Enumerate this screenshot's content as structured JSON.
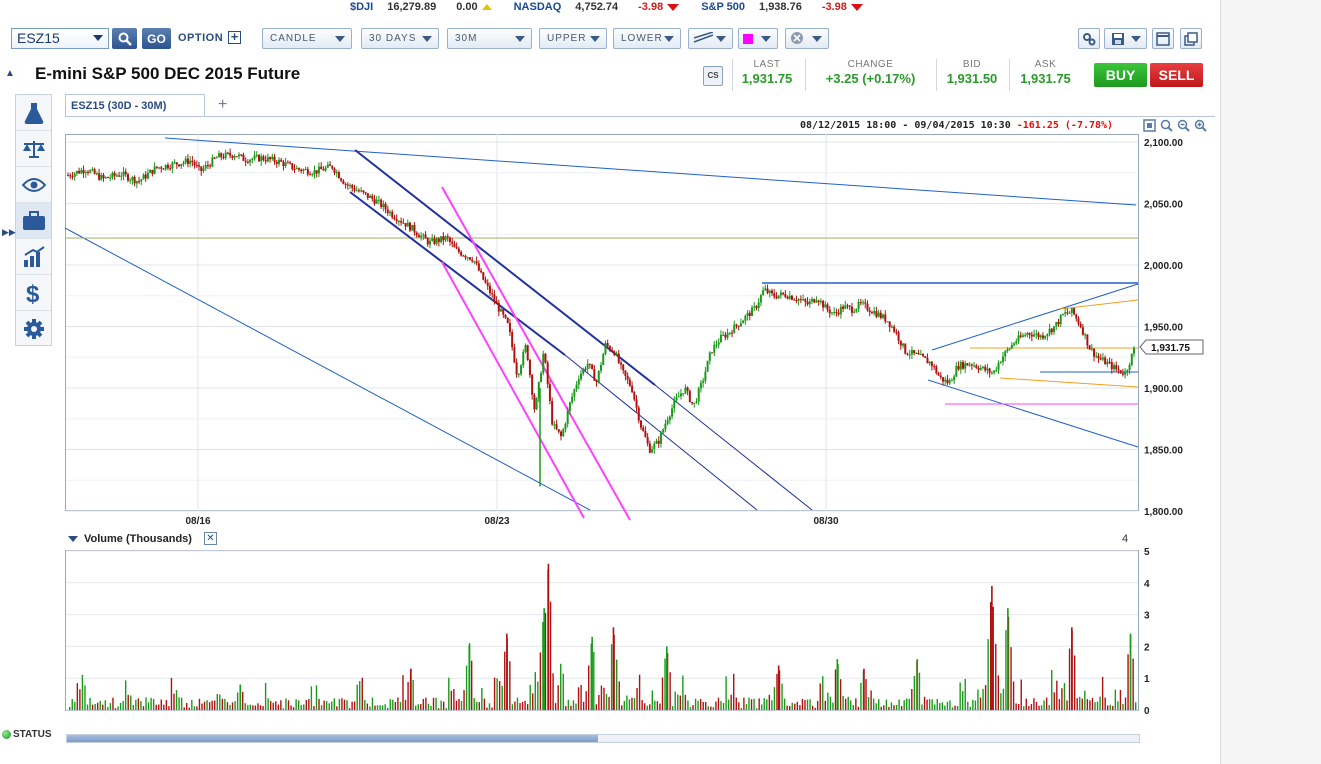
{
  "ticker": [
    {
      "symbol": "$DJI",
      "value": "16,279.89",
      "change": "0.00",
      "direction": "flat"
    },
    {
      "symbol": "NASDAQ",
      "value": "4,752.74",
      "change": "-3.98",
      "direction": "down"
    },
    {
      "symbol": "S&P 500",
      "value": "1,938.76",
      "change": "-3.98",
      "direction": "down"
    }
  ],
  "toolbar": {
    "symbol": "ESZ15",
    "go_label": "GO",
    "option_label": "OPTION",
    "chart_style": "CANDLE",
    "range": "30 DAYS",
    "interval": "30M",
    "upper": "UPPER",
    "lower": "LOWER",
    "draw_color": "#ff00ff"
  },
  "header": {
    "title": "E-mini S&P 500 DEC 2015 Future",
    "cs_label": "CS",
    "quotes": [
      {
        "label": "LAST",
        "value": "1,931.75"
      },
      {
        "label": "CHANGE",
        "value": "+3.25 (+0.17%)"
      },
      {
        "label": "BID",
        "value": "1,931.50"
      },
      {
        "label": "ASK",
        "value": "1,931.75"
      }
    ],
    "buy_label": "BUY",
    "sell_label": "SELL"
  },
  "side_tools": [
    "flask-icon",
    "scales-icon",
    "eye-icon",
    "briefcase-icon",
    "bar-chart-icon",
    "dollar-icon",
    "gear-icon"
  ],
  "chart": {
    "tab_label": "ESZ15 (30D - 30M)",
    "range_text": "08/12/2015 18:00 - 09/04/2015 10:30",
    "range_change": "-161.25 (-7.78%)",
    "last_price_tag": "1,931.75",
    "volume_label": "Volume (Thousands)",
    "volume_right_label": "4"
  },
  "chart_data": [
    {
      "type": "candlestick",
      "series_colors": {
        "up": "#1a9a1a",
        "down": "#b01010"
      },
      "y_ticks": [
        "2,100.00",
        "2,050.00",
        "2,000.00",
        "1,950.00",
        "1,900.00",
        "1,850.00",
        "1,800.00"
      ],
      "ylim": [
        1800,
        2100
      ],
      "x_ticks": [
        "08/16",
        "08/23",
        "08/30"
      ],
      "close_path": [
        [
          0,
          2073
        ],
        [
          4,
          2078
        ],
        [
          8,
          2070
        ],
        [
          12,
          2074
        ],
        [
          16,
          2068
        ],
        [
          20,
          2079
        ],
        [
          24,
          2082
        ],
        [
          28,
          2085
        ],
        [
          30,
          2076
        ],
        [
          34,
          2088
        ],
        [
          38,
          2090
        ],
        [
          40,
          2086
        ],
        [
          44,
          2087
        ],
        [
          48,
          2084
        ],
        [
          52,
          2078
        ],
        [
          56,
          2076
        ],
        [
          60,
          2080
        ],
        [
          63,
          2066
        ],
        [
          66,
          2060
        ],
        [
          70,
          2052
        ],
        [
          74,
          2040
        ],
        [
          78,
          2030
        ],
        [
          82,
          2018
        ],
        [
          86,
          2022
        ],
        [
          88,
          2012
        ],
        [
          92,
          2005
        ],
        [
          94,
          1990
        ],
        [
          97,
          1970
        ],
        [
          100,
          1950
        ],
        [
          102,
          1910
        ],
        [
          104,
          1935
        ],
        [
          106,
          1880
        ],
        [
          108,
          1930
        ],
        [
          110,
          1870
        ],
        [
          112,
          1860
        ],
        [
          114,
          1888
        ],
        [
          116,
          1910
        ],
        [
          118,
          1920
        ],
        [
          120,
          1905
        ],
        [
          122,
          1935
        ],
        [
          124,
          1930
        ],
        [
          126,
          1912
        ],
        [
          128,
          1900
        ],
        [
          130,
          1870
        ],
        [
          132,
          1850
        ],
        [
          134,
          1856
        ],
        [
          136,
          1875
        ],
        [
          138,
          1890
        ],
        [
          140,
          1900
        ],
        [
          142,
          1885
        ],
        [
          144,
          1905
        ],
        [
          146,
          1930
        ],
        [
          148,
          1940
        ],
        [
          150,
          1945
        ],
        [
          153,
          1955
        ],
        [
          156,
          1965
        ],
        [
          158,
          1980
        ],
        [
          160,
          1975
        ],
        [
          163,
          1976
        ],
        [
          166,
          1972
        ],
        [
          168,
          1968
        ],
        [
          170,
          1974
        ],
        [
          172,
          1965
        ],
        [
          174,
          1960
        ],
        [
          176,
          1966
        ],
        [
          178,
          1964
        ],
        [
          180,
          1968
        ],
        [
          183,
          1962
        ],
        [
          186,
          1955
        ],
        [
          188,
          1945
        ],
        [
          190,
          1930
        ],
        [
          193,
          1926
        ],
        [
          196,
          1920
        ],
        [
          198,
          1908
        ],
        [
          200,
          1904
        ],
        [
          202,
          1918
        ],
        [
          205,
          1920
        ],
        [
          208,
          1915
        ],
        [
          210,
          1912
        ],
        [
          212,
          1925
        ],
        [
          215,
          1938
        ],
        [
          218,
          1945
        ],
        [
          221,
          1942
        ],
        [
          224,
          1950
        ],
        [
          226,
          1960
        ],
        [
          228,
          1962
        ],
        [
          230,
          1950
        ],
        [
          232,
          1932
        ],
        [
          234,
          1924
        ],
        [
          236,
          1920
        ],
        [
          238,
          1915
        ],
        [
          240,
          1912
        ],
        [
          242,
          1931
        ]
      ],
      "close_x_max": 242
    },
    {
      "type": "bar",
      "title": "Volume (Thousands)",
      "y_ticks": [
        "5",
        "4",
        "3",
        "2",
        "1",
        "0"
      ],
      "ylim": [
        0,
        5
      ],
      "peaks": [
        {
          "x": 0.16,
          "value": 0.8
        },
        {
          "x": 0.32,
          "value": 1.3
        },
        {
          "x": 0.375,
          "value": 2.1
        },
        {
          "x": 0.41,
          "value": 2.4
        },
        {
          "x": 0.445,
          "value": 3.2
        },
        {
          "x": 0.449,
          "value": 4.6
        },
        {
          "x": 0.49,
          "value": 2.3
        },
        {
          "x": 0.51,
          "value": 2.6
        },
        {
          "x": 0.56,
          "value": 2.0
        },
        {
          "x": 0.665,
          "value": 1.4
        },
        {
          "x": 0.72,
          "value": 1.6
        },
        {
          "x": 0.745,
          "value": 1.3
        },
        {
          "x": 0.795,
          "value": 1.6
        },
        {
          "x": 0.865,
          "value": 3.9
        },
        {
          "x": 0.88,
          "value": 3.2
        },
        {
          "x": 0.94,
          "value": 2.6
        },
        {
          "x": 0.995,
          "value": 2.4
        }
      ]
    }
  ]
}
